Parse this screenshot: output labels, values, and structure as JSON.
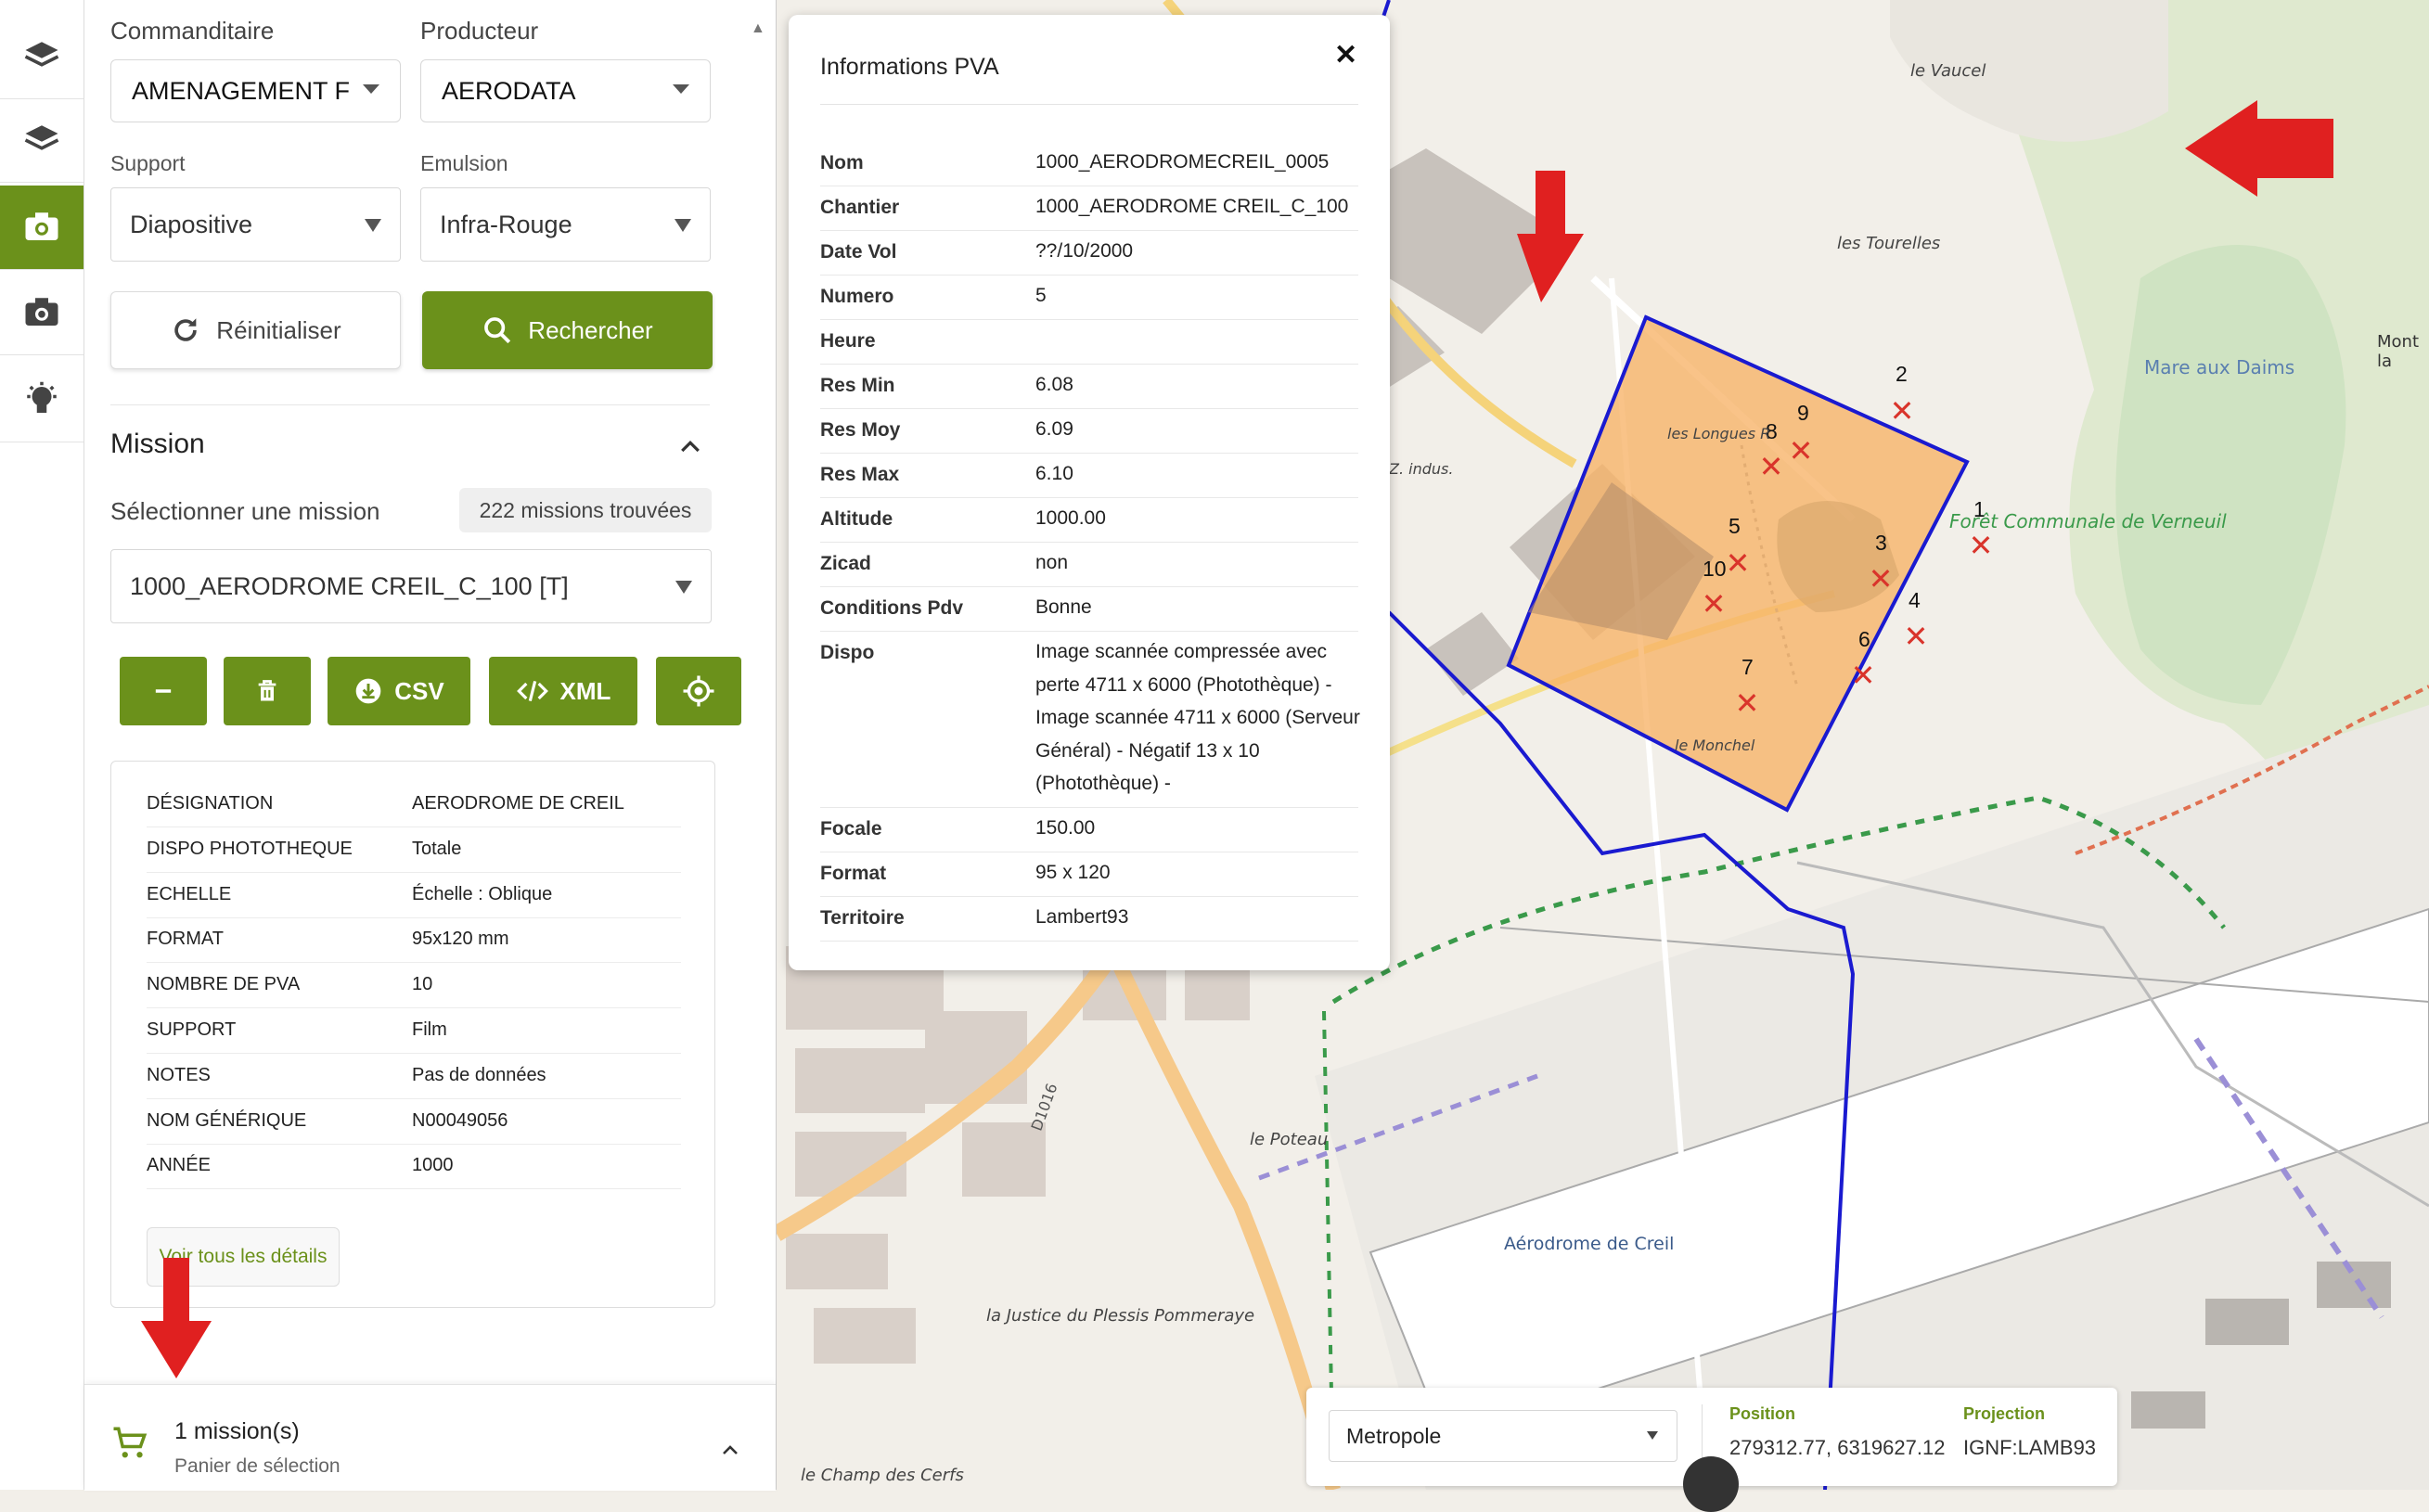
{
  "rail": {
    "items": [
      {
        "name": "layers-icon"
      },
      {
        "name": "layers-icon-2"
      },
      {
        "name": "camera-icon-active"
      },
      {
        "name": "camera-icon"
      },
      {
        "name": "lightbulb-icon"
      }
    ]
  },
  "filters": {
    "commanditaire_label": "Commanditaire",
    "commanditaire_value": "AMENAGEMENT F",
    "producteur_label": "Producteur",
    "producteur_value": "AERODATA",
    "support_label": "Support",
    "support_value": "Diapositive",
    "emulsion_label": "Emulsion",
    "emulsion_value": "Infra-Rouge",
    "reset_label": "Réinitialiser",
    "search_label": "Rechercher"
  },
  "mission": {
    "title": "Mission",
    "select_label": "Sélectionner une mission",
    "count_badge": "222 missions trouvées",
    "selected": "1000_AERODROME CREIL_C_100 [T]",
    "csv_label": "CSV",
    "xml_label": "XML",
    "details": [
      {
        "key": "DÉSIGNATION",
        "value": "AERODROME DE CREIL"
      },
      {
        "key": "DISPO PHOTOTHEQUE",
        "value": "Totale"
      },
      {
        "key": "ECHELLE",
        "value": "Échelle : Oblique"
      },
      {
        "key": "FORMAT",
        "value": "95x120 mm"
      },
      {
        "key": "NOMBRE DE PVA",
        "value": "10"
      },
      {
        "key": "SUPPORT",
        "value": "Film"
      },
      {
        "key": "NOTES",
        "value": "Pas de données"
      },
      {
        "key": "NOM GÉNÉRIQUE",
        "value": "N00049056"
      },
      {
        "key": "ANNÉE",
        "value": "1000"
      }
    ],
    "details_link": "Voir tous les détails"
  },
  "cart": {
    "title": "1 mission(s)",
    "subtitle": "Panier de sélection"
  },
  "popup": {
    "title": "Informations PVA",
    "close": "✕",
    "rows": [
      {
        "key": "Nom",
        "value": "1000_AERODROMECREIL_0005"
      },
      {
        "key": "Chantier",
        "value": "1000_AERODROME CREIL_C_100"
      },
      {
        "key": "Date Vol",
        "value": "??/10/2000"
      },
      {
        "key": "Numero",
        "value": "5"
      },
      {
        "key": "Heure",
        "value": ""
      },
      {
        "key": "Res Min",
        "value": "6.08"
      },
      {
        "key": "Res Moy",
        "value": "6.09"
      },
      {
        "key": "Res Max",
        "value": "6.10"
      },
      {
        "key": "Altitude",
        "value": "1000.00"
      },
      {
        "key": "Zicad",
        "value": "non"
      },
      {
        "key": "Conditions Pdv",
        "value": "Bonne"
      },
      {
        "key": "Dispo",
        "value": "Image scannée compressée avec perte 4711 x 6000 (Photothèque) - Image scannée 4711 x 6000 (Serveur Général) - Négatif 13 x 10 (Photothèque) -"
      },
      {
        "key": "Focale",
        "value": "150.00"
      },
      {
        "key": "Format",
        "value": "95 x 120"
      },
      {
        "key": "Territoire",
        "value": "Lambert93"
      }
    ]
  },
  "map": {
    "labels": {
      "vaucel": "le Vaucel",
      "tourelles": "les Tourelles",
      "mont": "Mont la",
      "mare": "Mare aux Daims",
      "foret": "Forêt Communale de Verneuil",
      "longues": "les Longues R",
      "indus": "Z. indus.",
      "monchel": "le Monchel",
      "poteau": "le Poteau",
      "aerodrome": "Aérodrome de Creil",
      "justice": "la Justice du Plessis Pommeraye",
      "champ": "le Champ des Cerfs",
      "road": "D1016"
    },
    "markers": [
      "1",
      "2",
      "3",
      "4",
      "5",
      "6",
      "7",
      "8",
      "9",
      "10"
    ]
  },
  "coords": {
    "territory": "Metropole",
    "position_label": "Position",
    "position_value": "279312.77, 6319627.12",
    "projection_label": "Projection",
    "projection_value": "IGNF:LAMB93"
  },
  "colors": {
    "accent": "#6b911b",
    "footprint_fill": "#f7b267",
    "footprint_stroke": "#1a1ad0",
    "arrow": "#e02020",
    "marker": "#d9342b"
  }
}
